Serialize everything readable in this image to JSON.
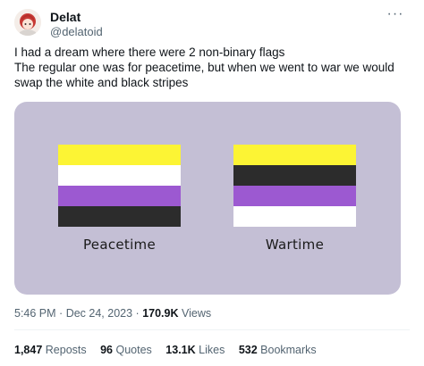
{
  "author": {
    "display_name": "Delat",
    "handle": "@delatoid",
    "avatar_icon": "avatar-icon"
  },
  "tweet": {
    "lines": [
      "I had a dream where there were 2 non-binary flags",
      "The regular one was for peacetime, but when we went to war we would",
      "swap the white and black stripes"
    ]
  },
  "media": {
    "background": "#c4bfd5",
    "flags": [
      {
        "label": "Peacetime",
        "stripes": [
          "#fcf434",
          "#ffffff",
          "#9c59d1",
          "#2c2c2c"
        ]
      },
      {
        "label": "Wartime",
        "stripes": [
          "#fcf434",
          "#2c2c2c",
          "#9c59d1",
          "#ffffff"
        ]
      }
    ]
  },
  "meta": {
    "time": "5:46 PM",
    "separator": "·",
    "date": "Dec 24, 2023",
    "views_count": "170.9K",
    "views_label": "Views"
  },
  "stats": [
    {
      "count": "1,847",
      "label": "Reposts"
    },
    {
      "count": "96",
      "label": "Quotes"
    },
    {
      "count": "13.1K",
      "label": "Likes"
    },
    {
      "count": "532",
      "label": "Bookmarks"
    }
  ],
  "icons": {
    "more": "more-options-icon"
  }
}
